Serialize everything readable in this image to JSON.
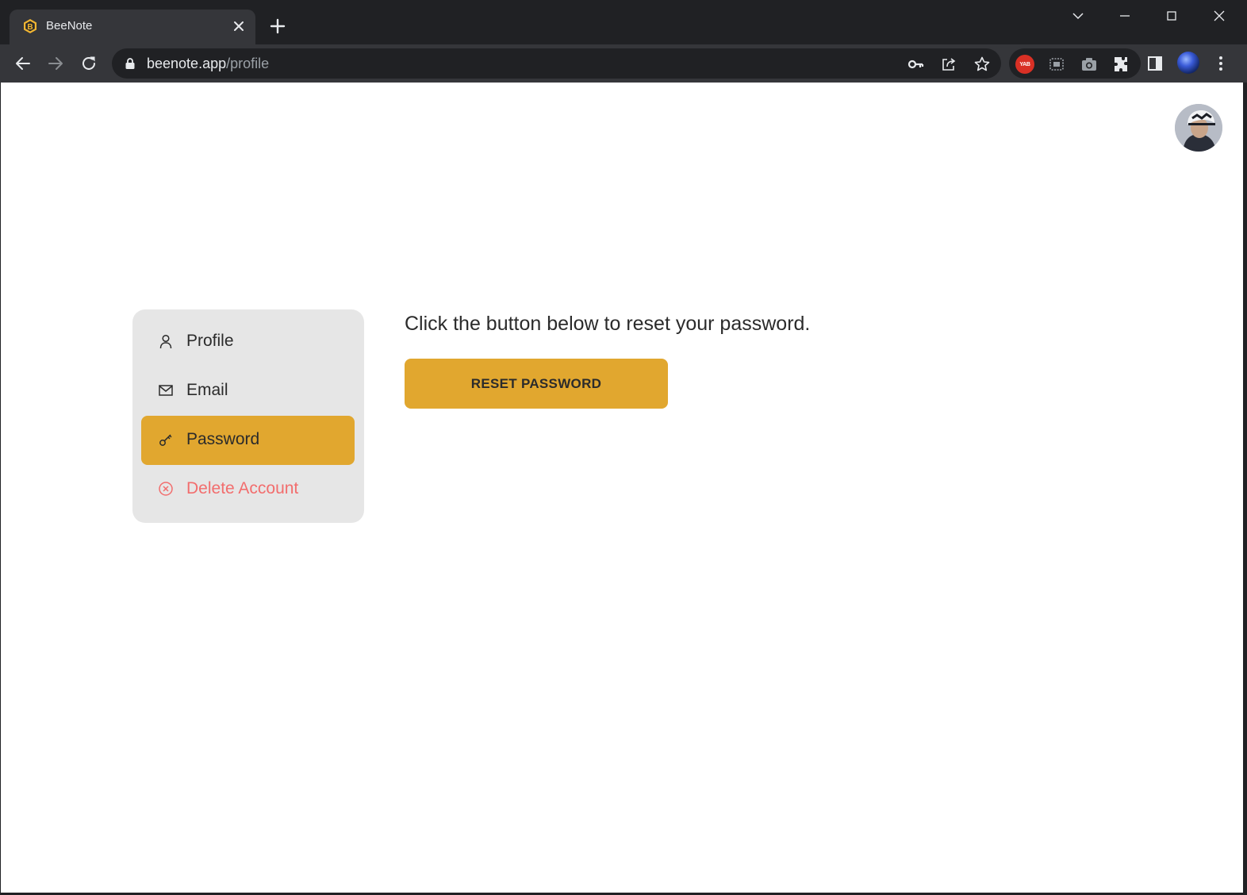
{
  "browser": {
    "tab_title": "BeeNote",
    "favicon_letter": "B",
    "url_host": "beenote.app",
    "url_path": "/profile",
    "extension_badge": "YAB"
  },
  "menu": {
    "items": [
      {
        "label": "Profile",
        "icon": "user-icon",
        "active": false
      },
      {
        "label": "Email",
        "icon": "mail-icon",
        "active": false
      },
      {
        "label": "Password",
        "icon": "key-icon",
        "active": true
      },
      {
        "label": "Delete Account",
        "icon": "x-circle-icon",
        "active": false
      }
    ]
  },
  "main": {
    "instructions": "Click the button below to reset your password.",
    "reset_button_label": "RESET PASSWORD"
  },
  "colors": {
    "accent": "#e1a72f",
    "danger": "#f26d6d",
    "menu_background": "#e6e6e6"
  }
}
